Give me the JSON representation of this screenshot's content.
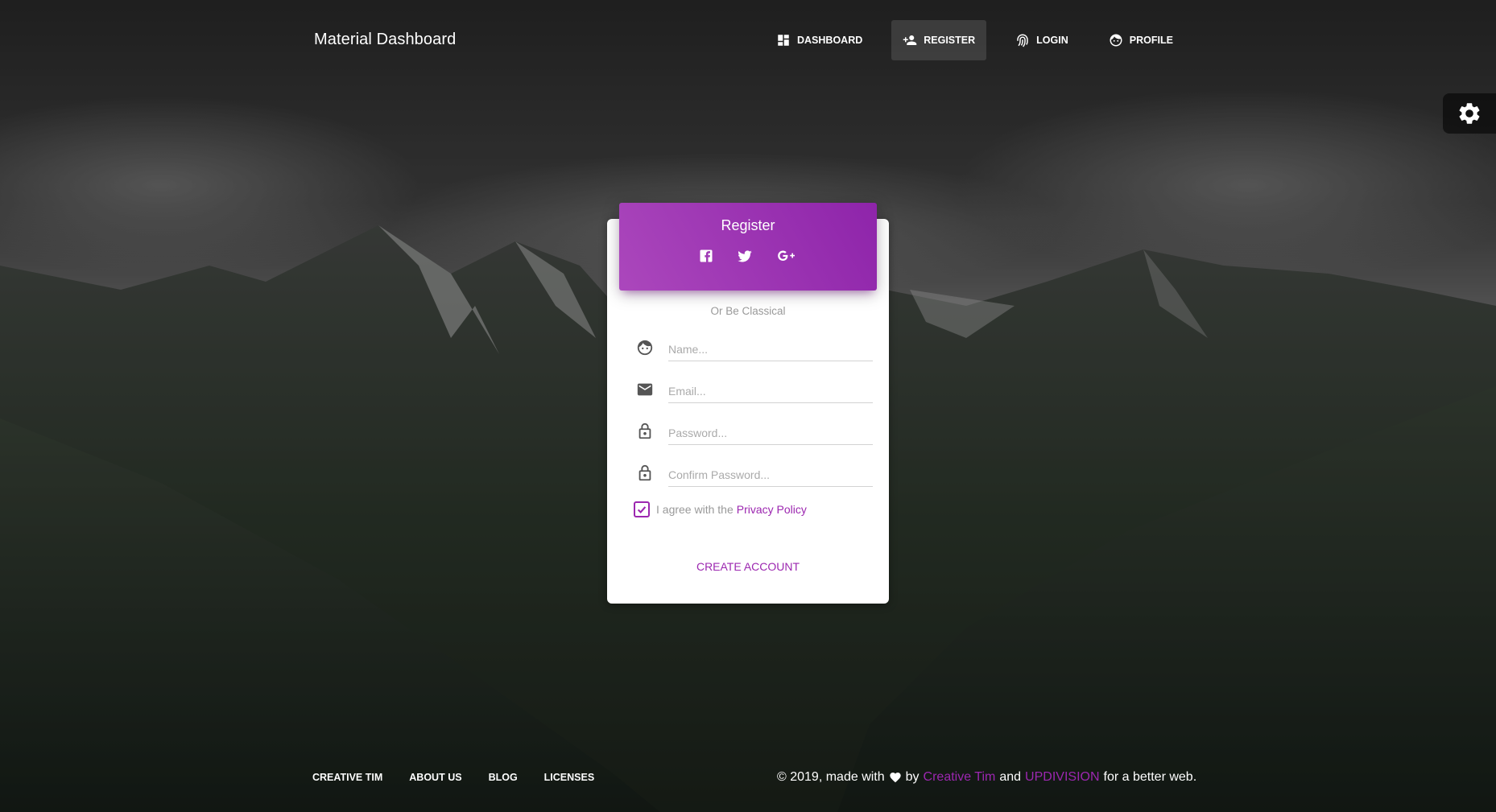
{
  "navbar": {
    "brand": "Material Dashboard",
    "items": [
      {
        "label": "Dashboard",
        "icon": "dashboard-icon"
      },
      {
        "label": "Register",
        "icon": "person-add-icon",
        "active": true
      },
      {
        "label": "Login",
        "icon": "fingerprint-icon"
      },
      {
        "label": "Profile",
        "icon": "face-icon"
      }
    ]
  },
  "settings": {
    "icon": "gear-icon"
  },
  "card": {
    "title": "Register",
    "social": [
      "facebook-icon",
      "twitter-icon",
      "google-plus-icon"
    ],
    "subtitle": "Or Be Classical",
    "fields": {
      "name": {
        "placeholder": "Name...",
        "icon": "face-icon"
      },
      "email": {
        "placeholder": "Email...",
        "icon": "mail-icon"
      },
      "password": {
        "placeholder": "Password...",
        "icon": "lock-icon"
      },
      "confirm": {
        "placeholder": "Confirm Password...",
        "icon": "lock-icon"
      }
    },
    "agree_text": "I agree with the",
    "privacy_link": "Privacy Policy",
    "agree_checked": true,
    "submit": "Create Account"
  },
  "footer": {
    "links": [
      "Creative Tim",
      "About Us",
      "Blog",
      "Licenses"
    ],
    "copyright_prefix": "© 2019, made with",
    "by": "by",
    "author1": "Creative Tim",
    "and": "and",
    "author2": "UPDIVISION",
    "suffix": "for a better web."
  },
  "colors": {
    "accent": "#9c27b0",
    "header_gradient_start": "#ab47bc",
    "header_gradient_end": "#8e24aa"
  }
}
